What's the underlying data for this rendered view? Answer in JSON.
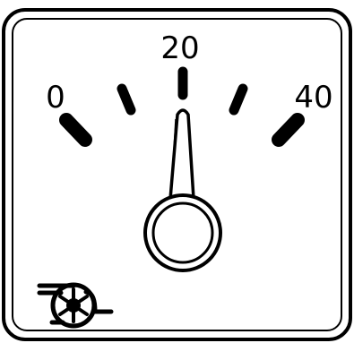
{
  "gauge": {
    "type": "turbo boost gauge",
    "scale": {
      "min": 0,
      "max": 40,
      "labels": [
        "0",
        "20",
        "40"
      ]
    },
    "needle_value": 20,
    "icon": "turbo-icon",
    "colors": {
      "stroke": "#000000",
      "background": "#ffffff"
    }
  }
}
